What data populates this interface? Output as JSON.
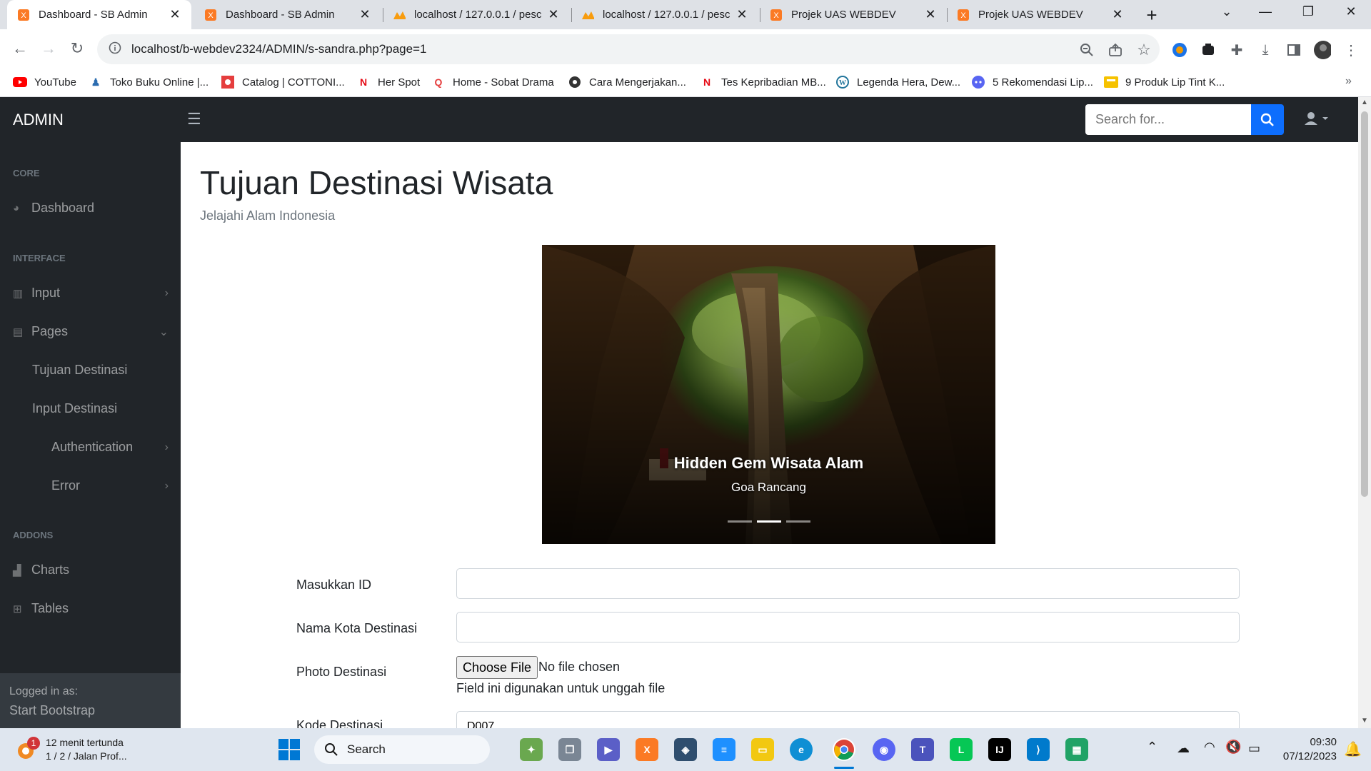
{
  "browser": {
    "tabs": [
      {
        "title": "Dashboard - SB Admin",
        "active": true
      },
      {
        "title": "Dashboard - SB Admin",
        "active": false
      },
      {
        "title": "localhost / 127.0.0.1 / pesc",
        "active": false
      },
      {
        "title": "localhost / 127.0.0.1 / pesc",
        "active": false
      },
      {
        "title": "Projek UAS WEBDEV",
        "active": false
      },
      {
        "title": "Projek UAS WEBDEV",
        "active": false
      }
    ],
    "url": "localhost/b-webdev2324/ADMIN/s-sandra.php?page=1",
    "bookmarks": [
      "YouTube",
      "Toko Buku Online |...",
      "Catalog | COTTONI...",
      "Her Spot",
      "Home - Sobat Drama",
      "Cara Mengerjakan...",
      "Tes Kepribadian MB...",
      "Legenda Hera, Dew...",
      "5 Rekomendasi Lip...",
      "9 Produk Lip Tint K..."
    ]
  },
  "app": {
    "brand": "ADMIN",
    "search_placeholder": "Search for...",
    "sidebar": {
      "core_heading": "CORE",
      "dashboard": "Dashboard",
      "interface_heading": "INTERFACE",
      "input": "Input",
      "pages": "Pages",
      "tujuan": "Tujuan Destinasi",
      "input_destinasi": "Input Destinasi",
      "authentication": "Authentication",
      "error": "Error",
      "addons_heading": "ADDONS",
      "charts": "Charts",
      "tables": "Tables",
      "logged_in_as": "Logged in as:",
      "user": "Start Bootstrap"
    },
    "page": {
      "title": "Tujuan Destinasi Wisata",
      "subtitle": "Jelajahi Alam Indonesia",
      "carousel": {
        "caption_title": "Hidden Gem Wisata Alam",
        "caption_text": "Goa Rancang",
        "slides": 3,
        "active_slide": 2
      },
      "form": {
        "id_label": "Masukkan ID",
        "id_value": "",
        "nama_label": "Nama Kota Destinasi",
        "nama_value": "",
        "photo_label": "Photo Destinasi",
        "choose_file": "Choose File",
        "no_file": "No file chosen",
        "photo_help": "Field ini digunakan untuk unggah file",
        "kode_label": "Kode Destinasi",
        "kode_value": "D007"
      }
    }
  },
  "taskbar": {
    "notif_count": "1",
    "notif_line1": "12 menit tertunda",
    "notif_line2": "1 / 2 / Jalan Prof...",
    "search_label": "Search",
    "time": "09:30",
    "date": "07/12/2023"
  },
  "colors": {
    "sidebar_bg": "#212529",
    "accent": "#0d6efd",
    "chrome_tabbar": "#dee1e6"
  }
}
